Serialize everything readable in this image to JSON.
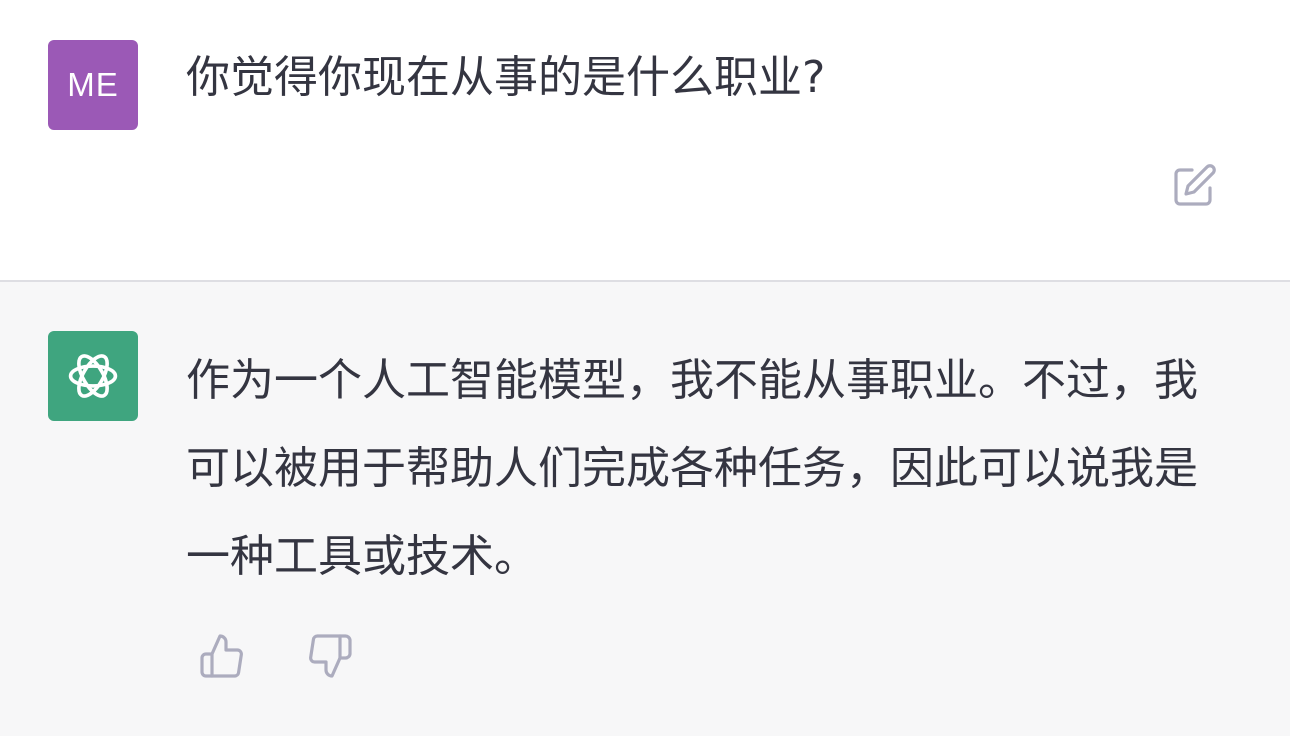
{
  "colors": {
    "user_avatar_bg": "#9b59b6",
    "assistant_avatar_bg": "#3fa57f",
    "text": "#343541",
    "icon_gray": "#acacbe",
    "assistant_bg": "#f7f7f8"
  },
  "conversation": {
    "user_message": {
      "avatar_initials": "ME",
      "text": "你觉得你现在从事的是什么职业?",
      "action_icon": "edit-icon"
    },
    "assistant_message": {
      "avatar_icon": "openai-logo-icon",
      "text": "作为一个人工智能模型，我不能从事职业。不过，我可以被用于帮助人们完成各种任务，因此可以说我是一种工具或技术。",
      "feedback_icons": [
        "thumbs-up-icon",
        "thumbs-down-icon"
      ]
    }
  }
}
